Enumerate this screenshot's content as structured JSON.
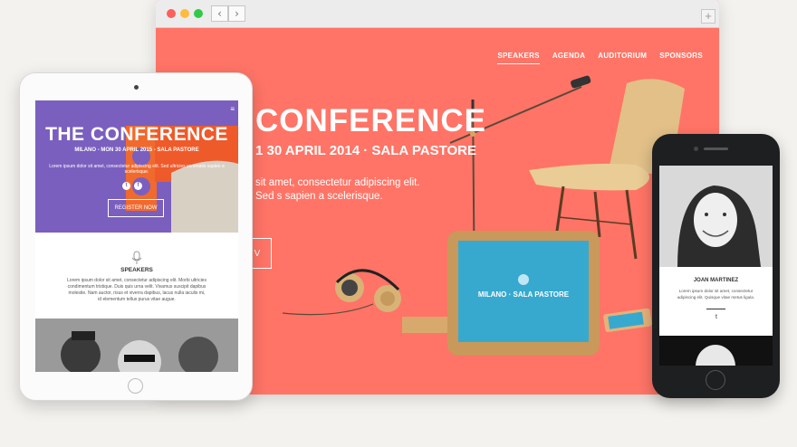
{
  "browser": {
    "nav": {
      "back": "‹",
      "forward": "›",
      "new_tab": "+"
    },
    "menu": [
      "SPEAKERS",
      "AGENDA",
      "AUDITORIUM",
      "SPONSORS"
    ],
    "hero_title": "CONFERENCE",
    "hero_subtitle": "1 30 APRIL 2014 · SALA PASTORE",
    "hero_text": "sit amet, consectetur adipiscing elit. Sed s sapien a scelerisque.",
    "hero_button": "V",
    "tablet_graphic_label": "MILANO · SALA PASTORE",
    "colors": {
      "accent": "#ff7466"
    }
  },
  "tablet": {
    "menu_icon": "≡",
    "hero_title": "THE CONFERENCE",
    "hero_subtitle": "MILANO - MON 30 APRIL 2015 - SALA PASTORE",
    "hero_text": "Lorem ipsum dolor sit amet, consectetur adipiscing elit. Sed ultricies venenatis sapien a scelerisque.",
    "social": {
      "twitter": "t",
      "facebook": "f"
    },
    "register_button": "REGISTER NOW",
    "speakers_title": "SPEAKERS",
    "speakers_text": "Lorem ipsum dolor sit amet, consectetur adipiscing elit. Morbi ultricies condimentum tristique. Duis quis urna velit. Vivamus suscipit dapibus molestie. Nam auctor, risus et viverra dapibus, lacus nulla iaculis mi, id elementum tellus purus vitae augue.",
    "colors": {
      "hero": "#7a5fbf"
    }
  },
  "phone": {
    "speaker_name": "JOAN MARTINEZ",
    "speaker_text": "Lorem ipsum dolor sit amet, consectetur adipiscing elit. Quisque vitae metus ligula.",
    "twitter_icon": "t"
  }
}
